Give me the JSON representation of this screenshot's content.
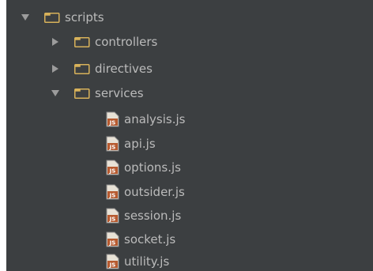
{
  "colors": {
    "panel_bg": "#3c3f41",
    "text": "#bbbbbb",
    "folder": "#d8b25a",
    "arrow": "#9c9c9c",
    "js_icon_bg": "#b75a2f"
  },
  "tree": {
    "root": {
      "label": "scripts",
      "expanded": true,
      "icon": "folder-icon"
    },
    "folders": [
      {
        "label": "controllers",
        "expanded": false,
        "icon": "folder-icon"
      },
      {
        "label": "directives",
        "expanded": false,
        "icon": "folder-icon"
      },
      {
        "label": "services",
        "expanded": true,
        "icon": "folder-icon"
      }
    ],
    "files": [
      {
        "label": "analysis.js",
        "icon": "js-file-icon"
      },
      {
        "label": "api.js",
        "icon": "js-file-icon"
      },
      {
        "label": "options.js",
        "icon": "js-file-icon"
      },
      {
        "label": "outsider.js",
        "icon": "js-file-icon"
      },
      {
        "label": "session.js",
        "icon": "js-file-icon"
      },
      {
        "label": "socket.js",
        "icon": "js-file-icon"
      },
      {
        "label": "utility.js",
        "icon": "js-file-icon"
      }
    ],
    "js_icon_text": "JS"
  }
}
